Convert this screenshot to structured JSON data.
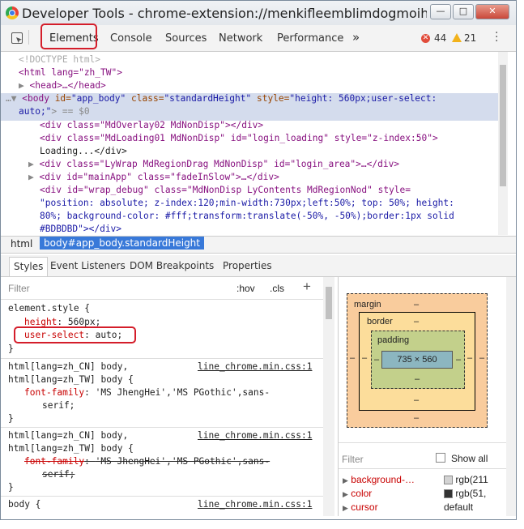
{
  "window": {
    "title": "Developer Tools - chrome-extension://menkifleemblimdogmoihpfop...",
    "buttons": [
      "—",
      "□",
      "✕"
    ]
  },
  "toolbar": {
    "tabs": [
      "Elements",
      "Console",
      "Sources",
      "Network",
      "Performance"
    ],
    "more": "»",
    "errors": "44",
    "warnings": "21"
  },
  "dom": {
    "doctype": "<!DOCTYPE html>",
    "html_open": "<html lang=\"zh_TW\">",
    "head": "<head>…</head>",
    "body_line1_tag": "<body",
    "body_id_attr": "id=",
    "body_id_val": "\"app_body\"",
    "body_class_attr": "class=",
    "body_class_val": "\"standardHeight\"",
    "body_style_attr": "style=",
    "body_style_val": "\"height: 560px;user-select:",
    "body_line2_val": "auto;\"",
    "body_line2_end": "> == $0",
    "line_overlay": "<div class=\"MdOverlay02 MdNonDisp\"></div>",
    "line_loading1": "<div class=\"MdLoading01 MdNonDisp\" id=\"login_loading\" style=\"z-index:50\">",
    "line_loading2": "Loading...</div>",
    "line_lywrap": "<div class=\"LyWrap MdRegionDrag MdNonDisp\" id=\"login_area\">…</div>",
    "line_mainapp": "<div id=\"mainApp\" class=\"fadeInSlow\">…</div>",
    "line_debug1": "<div id=\"wrap_debug\" class=\"MdNonDisp LyContents MdRegionNod\" style=",
    "line_debug2": "\"position: absolute; z-index:120;min-width:730px;left:50%; top: 50%; height:",
    "line_debug3": "80%; background-color: #fff;transform:translate(-50%, -50%);border:1px solid",
    "line_debug4": "#BDBDBD\"></div>"
  },
  "breadcrumbs": [
    "html",
    "body#app_body.standardHeight"
  ],
  "subtabs": [
    "Styles",
    "Event Listeners",
    "DOM Breakpoints",
    "Properties"
  ],
  "styles": {
    "filter_placeholder": "Filter",
    "hov": ":hov",
    "cls": ".cls",
    "add": "+",
    "element_style": "element.style {",
    "height_prop": "height",
    "height_val": "560px;",
    "us_prop": "user-select",
    "us_val": "auto;",
    "close": "}",
    "rule1_sel1": "html[lang=zh_CN] body,",
    "rule1_sel2": "html[lang=zh_TW] body {",
    "rule1_src": "line_chrome.min.css:1",
    "ff_prop": "font-family",
    "ff_val1": "'MS JhengHei','MS PGothic',sans-",
    "ff_val2": "serif;",
    "rule2_sel1": "html[lang=zh_CN] body,",
    "rule2_sel2": "html[lang=zh_TW] body {",
    "rule2_src": "line_chrome.min.css:1",
    "rule3_sel": "body {",
    "rule3_src": "line_chrome.min.css:1"
  },
  "boxmodel": {
    "margin_label": "margin",
    "border_label": "border",
    "padding_label": "padding",
    "dash": "–",
    "content": "735 × 560"
  },
  "computed": {
    "filter_placeholder": "Filter",
    "show_all": "Show all",
    "rows": [
      {
        "prop": "background-…",
        "value": "rgb(211",
        "swatch": "#d3d3d3"
      },
      {
        "prop": "color",
        "value": "rgb(51,",
        "swatch": "#333333"
      },
      {
        "prop": "cursor",
        "value": "default",
        "swatch": ""
      }
    ]
  }
}
